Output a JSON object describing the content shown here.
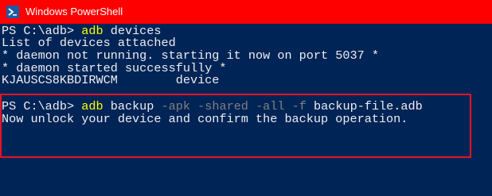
{
  "window": {
    "title": "Windows PowerShell",
    "icon": "powershell-icon",
    "titlebar_color": "#ff0000",
    "background_color": "#012456"
  },
  "console": {
    "line1": {
      "prompt": "PS C:\\adb> ",
      "command": "adb",
      "rest": " devices"
    },
    "line2": "List of devices attached",
    "line3": "* daemon not running. starting it now on port 5037 *",
    "line4": "* daemon started successfully *",
    "line5": "KJAUSCS8KBDIRWCM        device",
    "line6": {
      "prompt": "PS C:\\adb> ",
      "command": "adb",
      "arg1": " backup ",
      "param1": "-apk",
      "sp1": " ",
      "param2": "-shared",
      "sp2": " ",
      "param3": "-all",
      "sp3": " ",
      "param4": "-f",
      "arg2": " backup-file.adb"
    },
    "line7": "Now unlock your device and confirm the backup operation."
  },
  "colors": {
    "command": "#ffff00",
    "parameter": "#808080",
    "text": "#eeedf0",
    "highlight_border": "#e81123"
  }
}
